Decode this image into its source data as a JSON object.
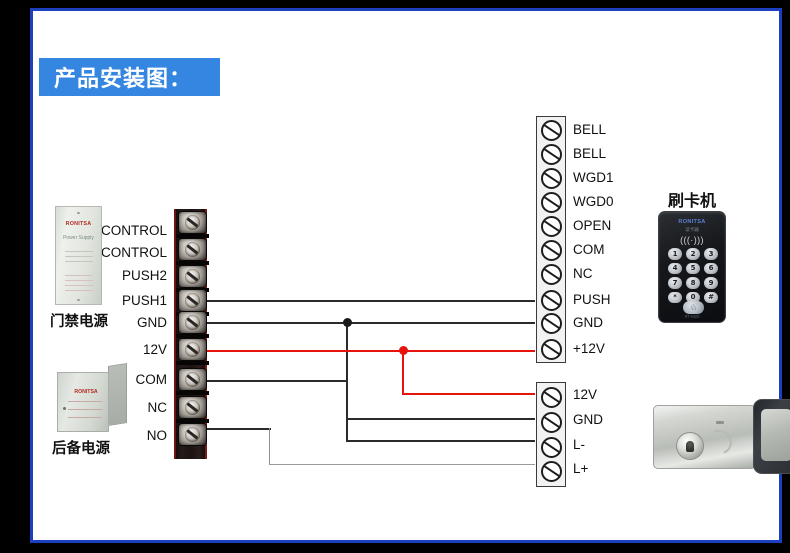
{
  "page": {
    "title_banner": "产品安装图：",
    "frame_color": "#1b3fbe",
    "banner_color": "#3586e0",
    "background": "#ffffff"
  },
  "left_terminal_block": {
    "name": "controller-terminal-block",
    "terminals": [
      {
        "label": "CONTROL"
      },
      {
        "label": "CONTROL"
      },
      {
        "label": "PUSH2"
      },
      {
        "label": "PUSH1"
      },
      {
        "label": "GND"
      },
      {
        "label": "12V"
      },
      {
        "label": "COM"
      },
      {
        "label": "NC"
      },
      {
        "label": "NO"
      }
    ]
  },
  "right_upper_terminal_block": {
    "name": "card-reader-terminal-block",
    "terminals": [
      {
        "label": "BELL"
      },
      {
        "label": "BELL"
      },
      {
        "label": "WGD1"
      },
      {
        "label": "WGD0"
      },
      {
        "label": "OPEN"
      },
      {
        "label": "COM"
      },
      {
        "label": "NC"
      },
      {
        "label": "PUSH"
      },
      {
        "label": "GND"
      },
      {
        "label": "+12V"
      }
    ]
  },
  "right_lower_terminal_block": {
    "name": "lock-terminal-block",
    "terminals": [
      {
        "label": "12V"
      },
      {
        "label": "GND"
      },
      {
        "label": "L-"
      },
      {
        "label": "L+"
      }
    ]
  },
  "devices": {
    "power_supply": {
      "caption": "门禁电源",
      "brand": "RONITSA",
      "subtitle": "Power Supply"
    },
    "backup_power": {
      "caption": "后备电源",
      "brand": "RONITSA"
    },
    "card_reader": {
      "caption": "刷卡机",
      "brand": "RONITSA",
      "subtitle": "读卡器",
      "wave_icon": "(((·)))",
      "keys": [
        [
          "1",
          "2",
          "3"
        ],
        [
          "4",
          "5",
          "6"
        ],
        [
          "7",
          "8",
          "9"
        ],
        [
          "*",
          "0",
          "#"
        ]
      ],
      "bell_key": "♘",
      "footer": "RT-M20"
    },
    "electric_lock": {
      "caption": ""
    }
  },
  "wires": {
    "colors": {
      "signal": "#2b2b2b",
      "power": "#e8120c",
      "thin": "#9a9a9a"
    },
    "connections": [
      {
        "from": "PUSH1",
        "to": "PUSH",
        "color": "signal"
      },
      {
        "from": "GND",
        "to": "GND (reader)",
        "color": "signal",
        "branch": "GND (lock)"
      },
      {
        "from": "12V",
        "to": "+12V",
        "color": "power",
        "branch": "12V (lock)"
      },
      {
        "from": "COM",
        "to": "L-",
        "color": "signal"
      },
      {
        "from": "NO",
        "to": "L+",
        "color": "thin"
      }
    ]
  }
}
